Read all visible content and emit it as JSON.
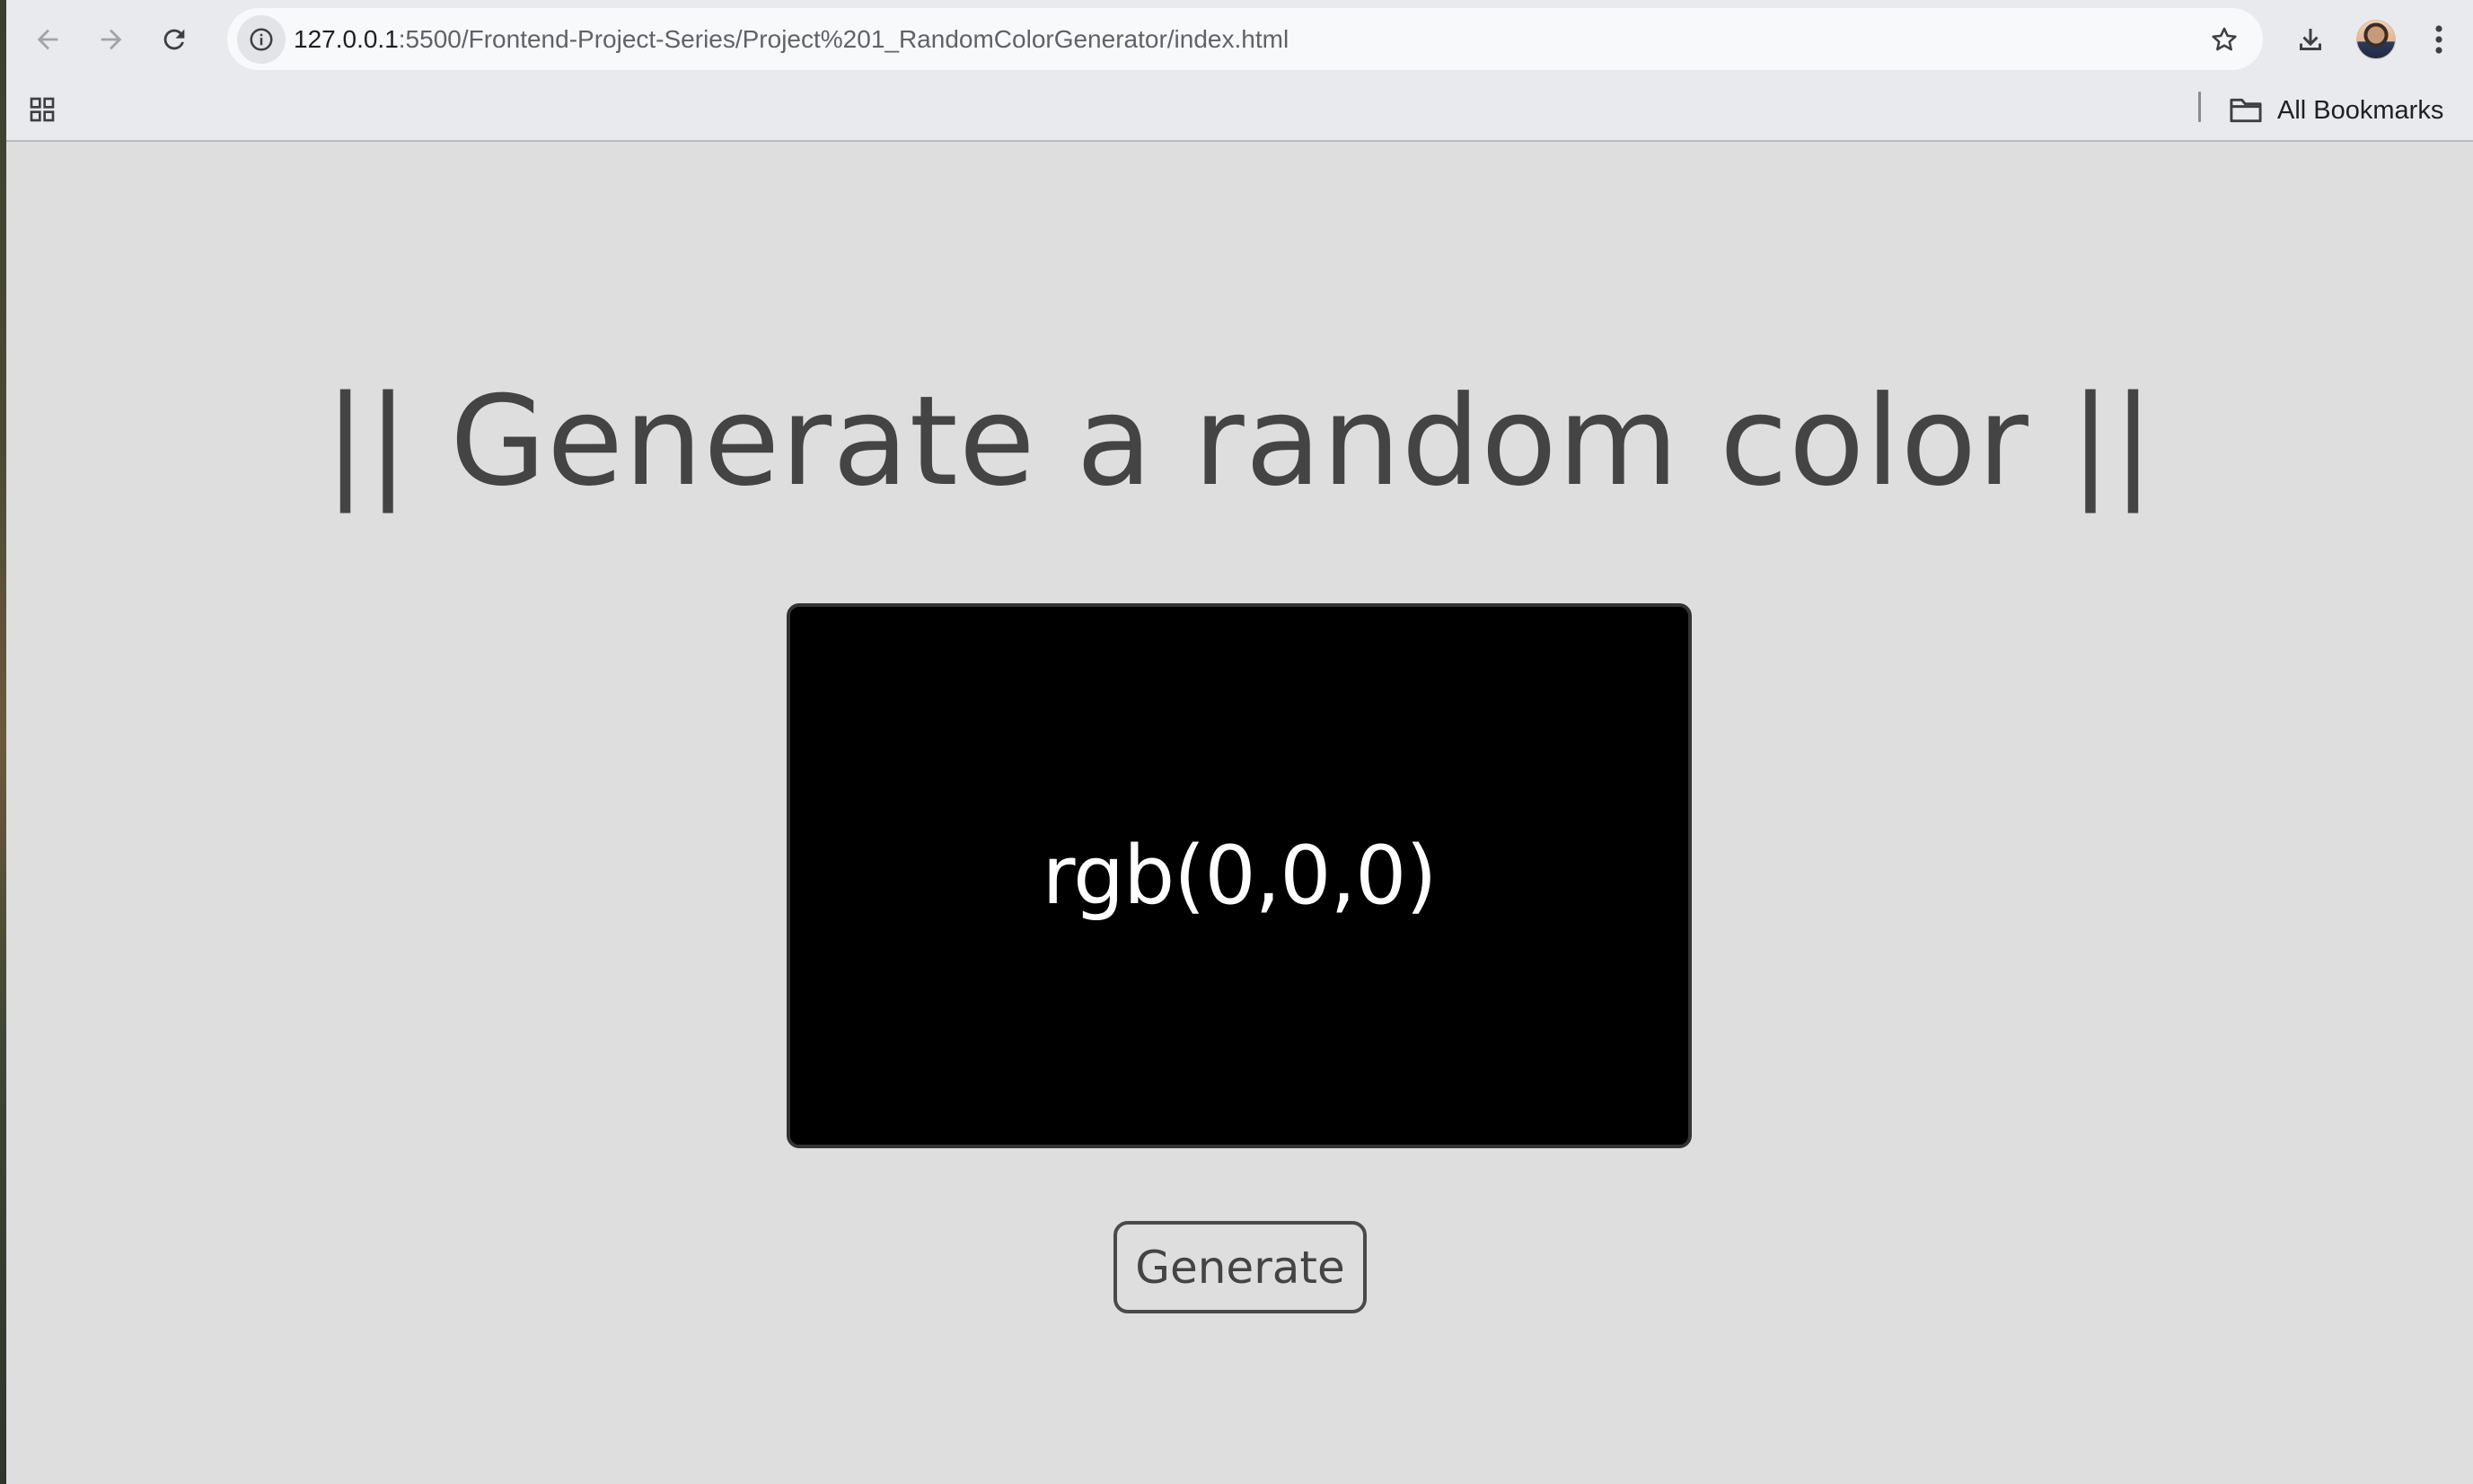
{
  "browser": {
    "url_host": "127.0.0.1",
    "url_rest": ":5500/Frontend-Project-Series/Project%201_RandomColorGenerator/index.html",
    "bookmarks_label": "All Bookmarks",
    "icons": {
      "back": "arrow-left-icon",
      "forward": "arrow-right-icon",
      "reload": "reload-icon",
      "site_info": "info-icon",
      "bookmark_star": "star-icon",
      "download": "download-icon",
      "profile": "avatar",
      "menu": "kebab-menu-icon",
      "apps": "apps-grid-icon",
      "folder": "folder-icon"
    }
  },
  "page": {
    "title": "|| Generate a random color ||",
    "color_display": {
      "value": "rgb(0,0,0)",
      "background": "#000000"
    },
    "generate_label": "Generate"
  },
  "colors": {
    "page_background": "#dedede",
    "chrome_background": "#e9eaed",
    "title_text": "#444444",
    "color_text": "#ffffff"
  }
}
